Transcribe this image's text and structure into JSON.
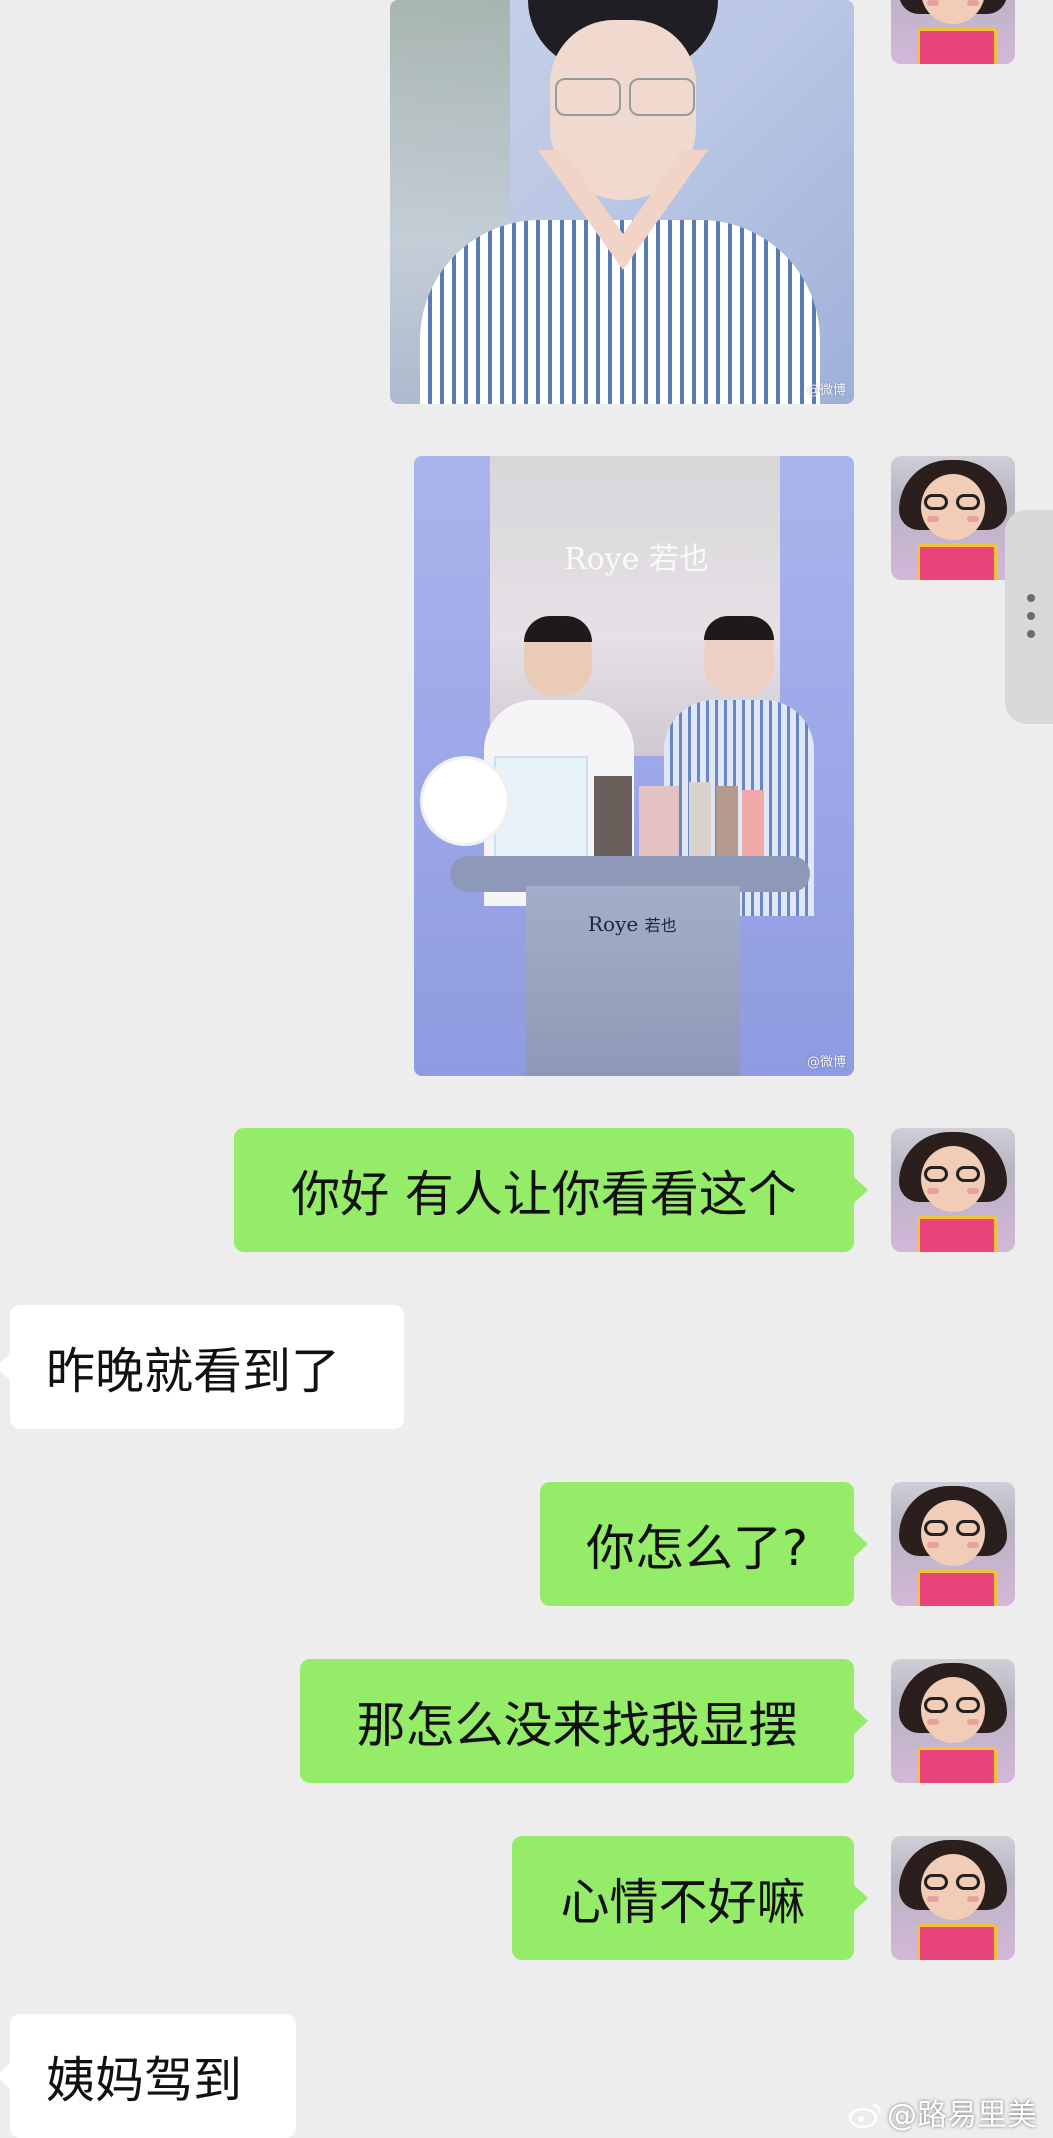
{
  "messages": [
    {
      "side": "out",
      "type": "image",
      "subject": "man-in-striped-shirt-portrait",
      "watermark": "@微博"
    },
    {
      "side": "out",
      "type": "image",
      "subject": "livestream-two-hosts",
      "brand": "Roye",
      "brand_cn": "若也",
      "watermark": "@微博"
    },
    {
      "side": "out",
      "type": "text",
      "text": "你好 有人让你看看这个"
    },
    {
      "side": "in",
      "type": "text",
      "text": "昨晚就看到了"
    },
    {
      "side": "out",
      "type": "text",
      "text": "你怎么了?"
    },
    {
      "side": "out",
      "type": "text",
      "text": "那怎么没来找我显摆"
    },
    {
      "side": "out",
      "type": "text",
      "text": "心情不好嘛"
    },
    {
      "side": "in",
      "type": "text",
      "text": "姨妈驾到"
    }
  ],
  "watermark": {
    "text": "@路易里美",
    "icon": "weibo-icon"
  },
  "colors": {
    "background": "#ededed",
    "outgoing_bubble": "#95ec69",
    "incoming_bubble": "#ffffff"
  }
}
